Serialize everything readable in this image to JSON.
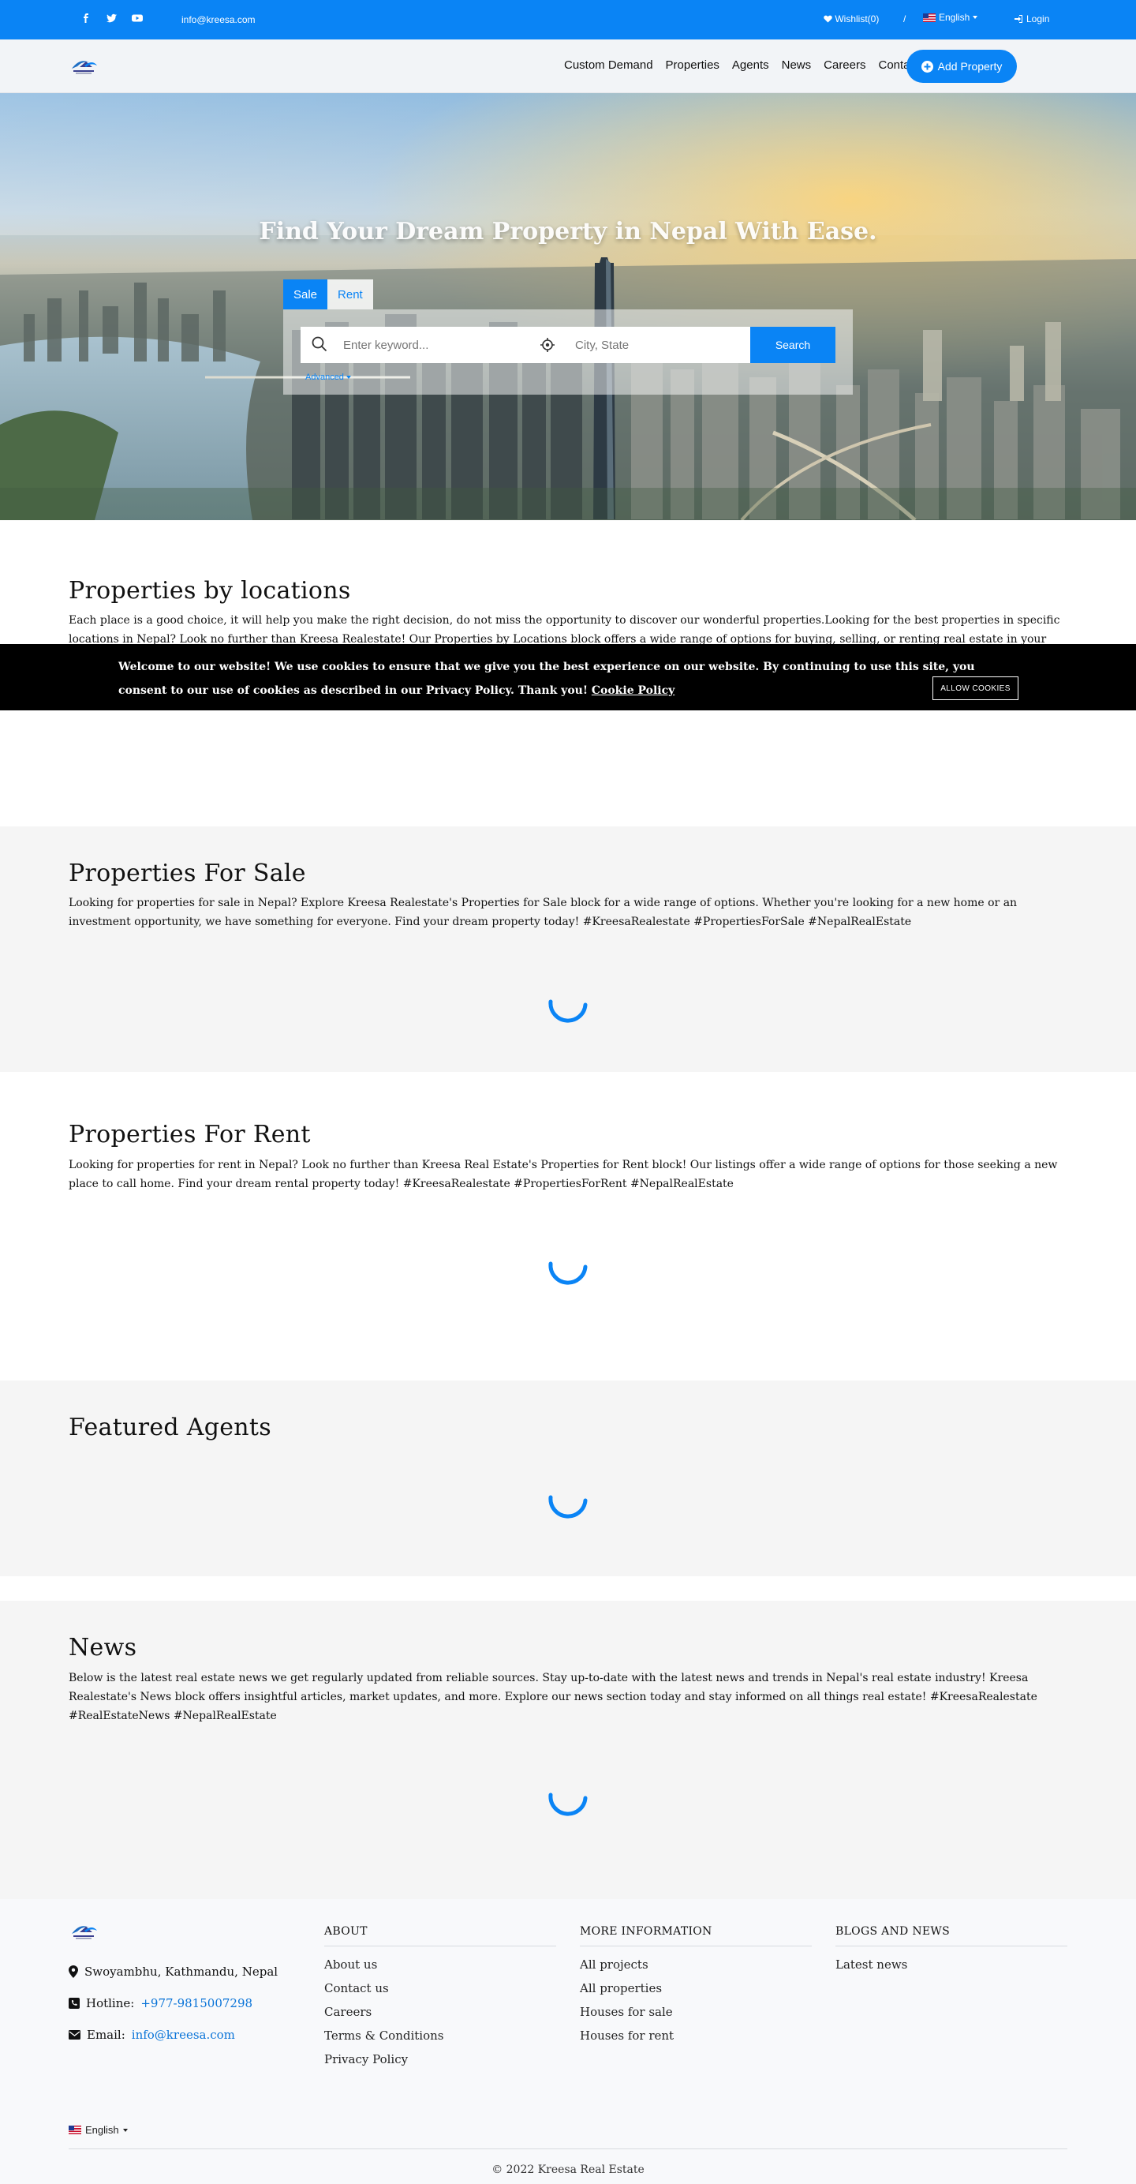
{
  "topbar": {
    "email": "info@kreesa.com",
    "wishlist": "Wishlist(0)",
    "separator": "/",
    "language": "English",
    "login": "Login",
    "social_icons": [
      "facebook-icon",
      "twitter-icon",
      "youtube-icon"
    ]
  },
  "nav": {
    "links": [
      "Custom Demand",
      "Properties",
      "Agents",
      "News",
      "Careers",
      "Contact"
    ],
    "add_property": "Add Property"
  },
  "hero": {
    "title": "Find Your Dream Property in Nepal With Ease.",
    "tabs": [
      "Sale",
      "Rent"
    ],
    "active_tab": "Sale",
    "keyword_placeholder": "Enter keyword...",
    "city_placeholder": "City, State",
    "search_label": "Search",
    "advanced_label": "Advanced"
  },
  "locations": {
    "title": "Properties by locations",
    "text": "Each place is a good choice, it will help you make the right decision, do not miss the opportunity to discover our wonderful properties.Looking for the best properties in specific locations in Nepal? Look no further than Kreesa Realestate! Our Properties by Locations block offers a wide range of options for buying, selling, or renting real estate in your"
  },
  "cookie": {
    "text": "Welcome to our website! We use cookies to ensure that we give you the best experience on our website. By continuing to use this site, you consent to our use of cookies as described in our Privacy Policy. Thank you!",
    "policy_link": "Cookie Policy",
    "button": "ALLOW COOKIES"
  },
  "sale": {
    "title": "Properties For Sale",
    "text": "Looking for properties for sale in Nepal? Explore Kreesa Realestate's Properties for Sale block for a wide range of options. Whether you're looking for a new home or an investment opportunity, we have something for everyone. Find your dream property today! #KreesaRealestate #PropertiesForSale #NepalRealEstate"
  },
  "rent": {
    "title": "Properties For Rent",
    "text": "Looking for properties for rent in Nepal? Look no further than Kreesa Real Estate's Properties for Rent block! Our listings offer a wide range of options for those seeking a new place to call home. Find your dream rental property today! #KreesaRealestate #PropertiesForRent #NepalRealEstate"
  },
  "agents": {
    "title": "Featured Agents"
  },
  "news": {
    "title": "News",
    "text": "Below is the latest real estate news we get regularly updated from reliable sources. Stay up-to-date with the latest news and trends in Nepal's real estate industry! Kreesa Realestate's News block offers insightful articles, market updates, and more. Explore our news section today and stay informed on all things real estate! #KreesaRealestate #RealEstateNews #NepalRealEstate"
  },
  "footer": {
    "address": "Swoyambhu, Kathmandu, Nepal",
    "hotline_label": "Hotline:",
    "hotline": "+977-9815007298",
    "email_label": "Email:",
    "email": "info@kreesa.com",
    "columns": [
      {
        "title": "ABOUT",
        "links": [
          "About us",
          "Contact us",
          "Careers",
          "Terms & Conditions",
          "Privacy Policy"
        ]
      },
      {
        "title": "MORE INFORMATION",
        "links": [
          "All projects",
          "All properties",
          "Houses for sale",
          "Houses for rent"
        ]
      },
      {
        "title": "BLOGS AND NEWS",
        "links": [
          "Latest news"
        ]
      }
    ],
    "language": "English",
    "copyright": "© 2022 Kreesa Real Estate"
  },
  "colors": {
    "primary": "#0a84f5",
    "topbar": "#0a84f5",
    "cookie_bg": "#000000",
    "section_alt": "#f5f5f5"
  }
}
